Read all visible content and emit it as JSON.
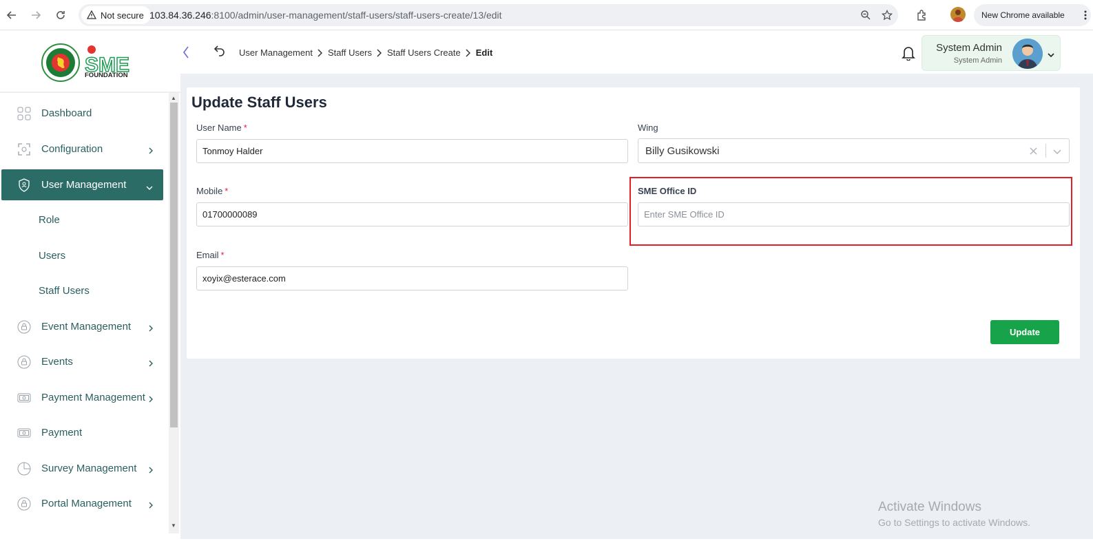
{
  "browser": {
    "security_label": "Not secure",
    "url_host": "103.84.36.246",
    "url_path": ":8100/admin/user-management/staff-users/staff-users-create/13/edit",
    "update_label": "New Chrome available"
  },
  "logo": {
    "text_sme": "SME",
    "text_foundation": "FOUNDATION"
  },
  "breadcrumb": [
    {
      "label": "User Management"
    },
    {
      "label": "Staff Users"
    },
    {
      "label": "Staff Users Create"
    },
    {
      "label": "Edit"
    }
  ],
  "user": {
    "name": "System Admin",
    "role": "System Admin"
  },
  "sidebar": {
    "items": [
      {
        "label": "Dashboard",
        "icon": "grid-icon"
      },
      {
        "label": "Configuration",
        "icon": "settings-icon"
      },
      {
        "label": "User Management",
        "icon": "shield-user-icon",
        "active": true
      },
      {
        "label": "Event Management",
        "icon": "lock-icon"
      },
      {
        "label": "Events",
        "icon": "lock-icon"
      },
      {
        "label": "Payment Management",
        "icon": "money-icon"
      },
      {
        "label": "Payment",
        "icon": "money-icon"
      },
      {
        "label": "Survey Management",
        "icon": "pie-chart-icon"
      },
      {
        "label": "Portal Management",
        "icon": "lock-icon"
      }
    ],
    "submenu": [
      {
        "label": "Role"
      },
      {
        "label": "Users"
      },
      {
        "label": "Staff Users"
      }
    ]
  },
  "form": {
    "title": "Update Staff Users",
    "user_name": {
      "label": "User Name",
      "value": "Tonmoy Halder"
    },
    "wing": {
      "label": "Wing",
      "value": "Billy Gusikowski"
    },
    "mobile": {
      "label": "Mobile",
      "value": "01700000089"
    },
    "sme_office_id": {
      "label": "SME Office ID",
      "placeholder": "Enter SME Office ID"
    },
    "email": {
      "label": "Email",
      "value": "xoyix@esterace.com"
    },
    "required_mark": "*",
    "submit_label": "Update"
  },
  "watermark": {
    "title": "Activate Windows",
    "subtitle": "Go to Settings to activate Windows."
  },
  "colors": {
    "sidebar_active": "#2b6c66",
    "primary_button": "#16a34a",
    "highlight": "#e31e24"
  }
}
